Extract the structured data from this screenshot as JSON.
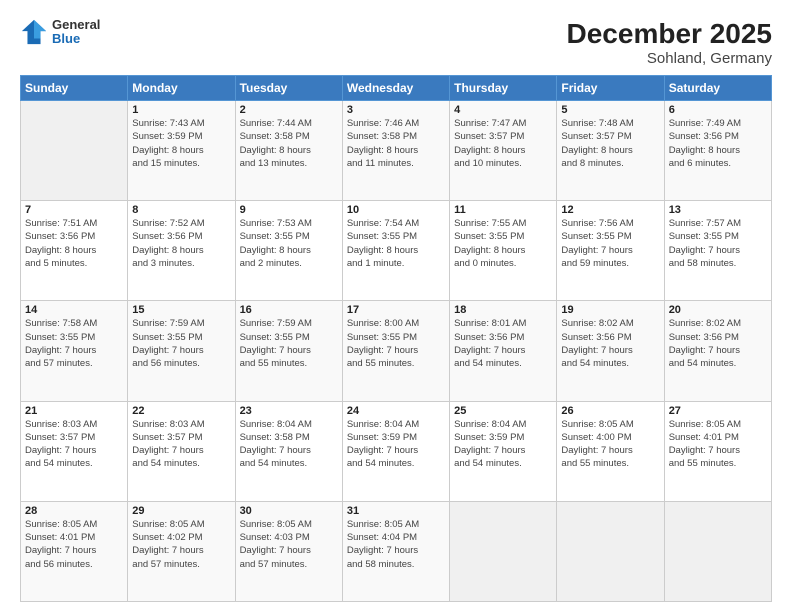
{
  "header": {
    "logo": {
      "general": "General",
      "blue": "Blue"
    },
    "title": "December 2025",
    "subtitle": "Sohland, Germany"
  },
  "days_of_week": [
    "Sunday",
    "Monday",
    "Tuesday",
    "Wednesday",
    "Thursday",
    "Friday",
    "Saturday"
  ],
  "weeks": [
    [
      {
        "day": "",
        "info": ""
      },
      {
        "day": "1",
        "info": "Sunrise: 7:43 AM\nSunset: 3:59 PM\nDaylight: 8 hours\nand 15 minutes."
      },
      {
        "day": "2",
        "info": "Sunrise: 7:44 AM\nSunset: 3:58 PM\nDaylight: 8 hours\nand 13 minutes."
      },
      {
        "day": "3",
        "info": "Sunrise: 7:46 AM\nSunset: 3:58 PM\nDaylight: 8 hours\nand 11 minutes."
      },
      {
        "day": "4",
        "info": "Sunrise: 7:47 AM\nSunset: 3:57 PM\nDaylight: 8 hours\nand 10 minutes."
      },
      {
        "day": "5",
        "info": "Sunrise: 7:48 AM\nSunset: 3:57 PM\nDaylight: 8 hours\nand 8 minutes."
      },
      {
        "day": "6",
        "info": "Sunrise: 7:49 AM\nSunset: 3:56 PM\nDaylight: 8 hours\nand 6 minutes."
      }
    ],
    [
      {
        "day": "7",
        "info": "Sunrise: 7:51 AM\nSunset: 3:56 PM\nDaylight: 8 hours\nand 5 minutes."
      },
      {
        "day": "8",
        "info": "Sunrise: 7:52 AM\nSunset: 3:56 PM\nDaylight: 8 hours\nand 3 minutes."
      },
      {
        "day": "9",
        "info": "Sunrise: 7:53 AM\nSunset: 3:55 PM\nDaylight: 8 hours\nand 2 minutes."
      },
      {
        "day": "10",
        "info": "Sunrise: 7:54 AM\nSunset: 3:55 PM\nDaylight: 8 hours\nand 1 minute."
      },
      {
        "day": "11",
        "info": "Sunrise: 7:55 AM\nSunset: 3:55 PM\nDaylight: 8 hours\nand 0 minutes."
      },
      {
        "day": "12",
        "info": "Sunrise: 7:56 AM\nSunset: 3:55 PM\nDaylight: 7 hours\nand 59 minutes."
      },
      {
        "day": "13",
        "info": "Sunrise: 7:57 AM\nSunset: 3:55 PM\nDaylight: 7 hours\nand 58 minutes."
      }
    ],
    [
      {
        "day": "14",
        "info": "Sunrise: 7:58 AM\nSunset: 3:55 PM\nDaylight: 7 hours\nand 57 minutes."
      },
      {
        "day": "15",
        "info": "Sunrise: 7:59 AM\nSunset: 3:55 PM\nDaylight: 7 hours\nand 56 minutes."
      },
      {
        "day": "16",
        "info": "Sunrise: 7:59 AM\nSunset: 3:55 PM\nDaylight: 7 hours\nand 55 minutes."
      },
      {
        "day": "17",
        "info": "Sunrise: 8:00 AM\nSunset: 3:55 PM\nDaylight: 7 hours\nand 55 minutes."
      },
      {
        "day": "18",
        "info": "Sunrise: 8:01 AM\nSunset: 3:56 PM\nDaylight: 7 hours\nand 54 minutes."
      },
      {
        "day": "19",
        "info": "Sunrise: 8:02 AM\nSunset: 3:56 PM\nDaylight: 7 hours\nand 54 minutes."
      },
      {
        "day": "20",
        "info": "Sunrise: 8:02 AM\nSunset: 3:56 PM\nDaylight: 7 hours\nand 54 minutes."
      }
    ],
    [
      {
        "day": "21",
        "info": "Sunrise: 8:03 AM\nSunset: 3:57 PM\nDaylight: 7 hours\nand 54 minutes."
      },
      {
        "day": "22",
        "info": "Sunrise: 8:03 AM\nSunset: 3:57 PM\nDaylight: 7 hours\nand 54 minutes."
      },
      {
        "day": "23",
        "info": "Sunrise: 8:04 AM\nSunset: 3:58 PM\nDaylight: 7 hours\nand 54 minutes."
      },
      {
        "day": "24",
        "info": "Sunrise: 8:04 AM\nSunset: 3:59 PM\nDaylight: 7 hours\nand 54 minutes."
      },
      {
        "day": "25",
        "info": "Sunrise: 8:04 AM\nSunset: 3:59 PM\nDaylight: 7 hours\nand 54 minutes."
      },
      {
        "day": "26",
        "info": "Sunrise: 8:05 AM\nSunset: 4:00 PM\nDaylight: 7 hours\nand 55 minutes."
      },
      {
        "day": "27",
        "info": "Sunrise: 8:05 AM\nSunset: 4:01 PM\nDaylight: 7 hours\nand 55 minutes."
      }
    ],
    [
      {
        "day": "28",
        "info": "Sunrise: 8:05 AM\nSunset: 4:01 PM\nDaylight: 7 hours\nand 56 minutes."
      },
      {
        "day": "29",
        "info": "Sunrise: 8:05 AM\nSunset: 4:02 PM\nDaylight: 7 hours\nand 57 minutes."
      },
      {
        "day": "30",
        "info": "Sunrise: 8:05 AM\nSunset: 4:03 PM\nDaylight: 7 hours\nand 57 minutes."
      },
      {
        "day": "31",
        "info": "Sunrise: 8:05 AM\nSunset: 4:04 PM\nDaylight: 7 hours\nand 58 minutes."
      },
      {
        "day": "",
        "info": ""
      },
      {
        "day": "",
        "info": ""
      },
      {
        "day": "",
        "info": ""
      }
    ]
  ]
}
